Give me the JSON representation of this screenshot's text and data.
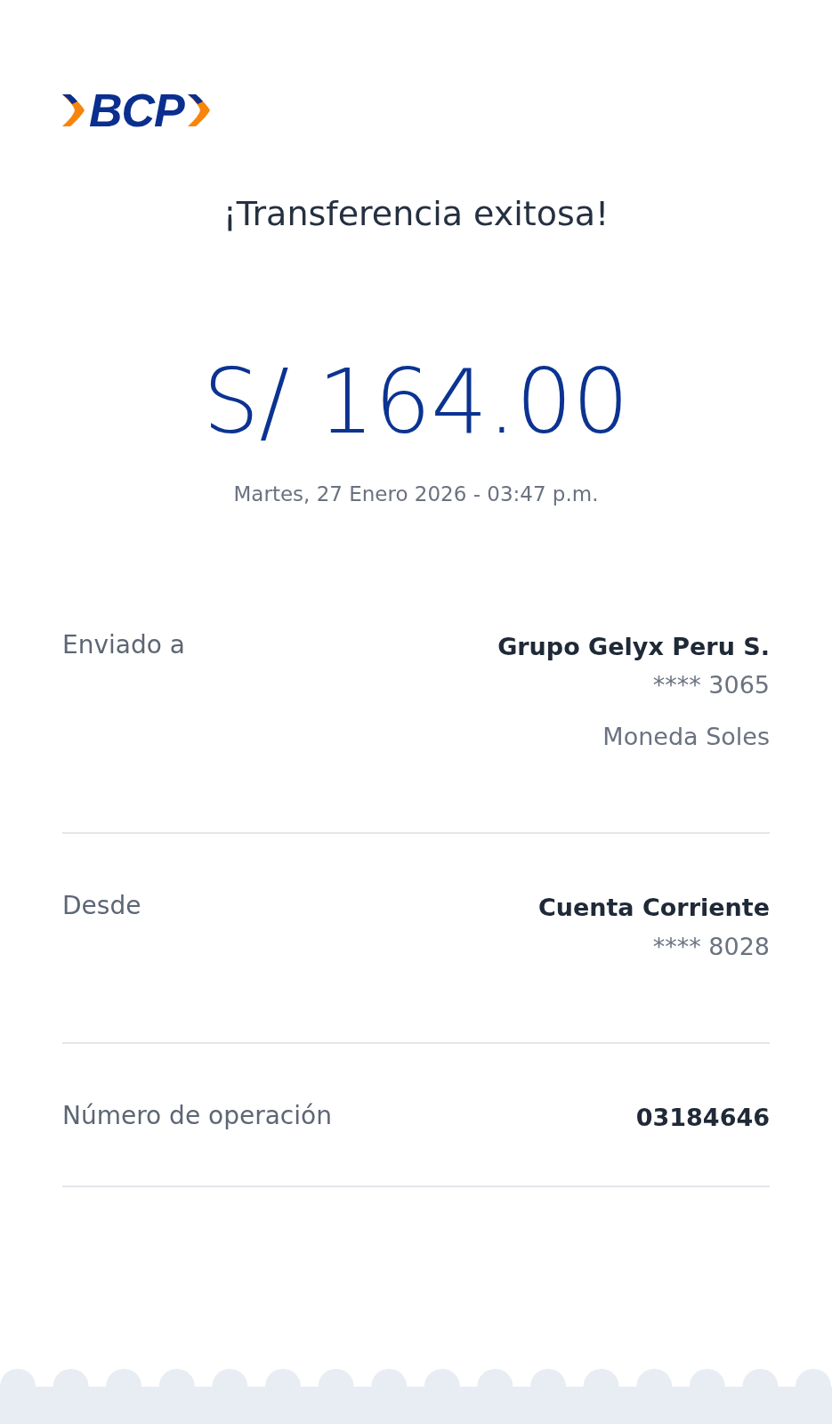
{
  "logo": {
    "text": "BCP"
  },
  "title": "¡Transferencia exitosa!",
  "amount": "S/ 164.00",
  "datetime": "Martes, 27 Enero 2026 - 03:47 p.m.",
  "details": [
    {
      "label": "Enviado a",
      "lines": [
        {
          "text": "Grupo Gelyx Peru S.",
          "kind": "strong"
        },
        {
          "text": "**** 3065",
          "kind": "muted"
        },
        {
          "text": "Moneda Soles",
          "kind": "note"
        }
      ]
    },
    {
      "label": "Desde",
      "lines": [
        {
          "text": "Cuenta Corriente",
          "kind": "strong"
        },
        {
          "text": "**** 8028",
          "kind": "muted"
        }
      ]
    },
    {
      "label": "Número de operación",
      "lines": [
        {
          "text": "03184646",
          "kind": "strong"
        }
      ]
    }
  ]
}
